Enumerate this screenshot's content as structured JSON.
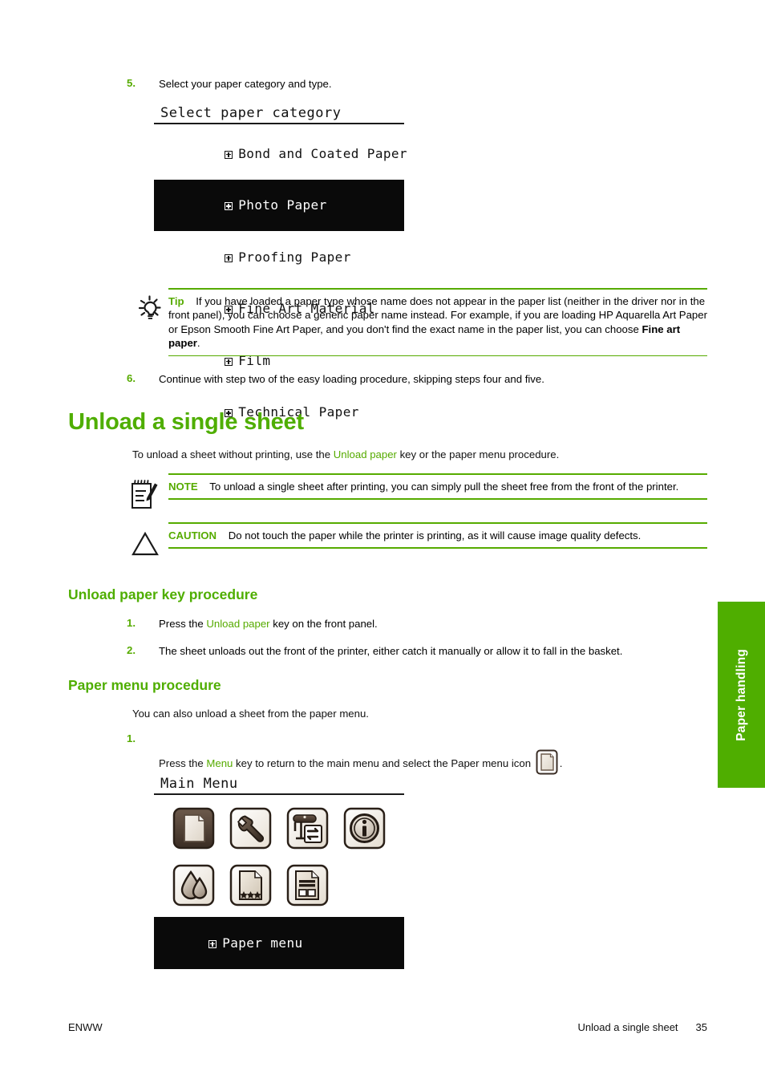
{
  "document": {
    "footer_left": "ENWW",
    "footer_section": "Unload a single sheet",
    "footer_page": "35",
    "side_tab": "Paper handling"
  },
  "steps_top": [
    {
      "num": "5.",
      "text": "Select your paper category and type."
    },
    {
      "num": "6.",
      "text": "Continue with step two of the easy loading procedure, skipping steps four and five."
    }
  ],
  "lcd_paper_category": {
    "title": "Select paper category",
    "rows": [
      {
        "label": "Bond and Coated Paper",
        "selected": false
      },
      {
        "label": "Photo Paper",
        "selected": true
      },
      {
        "label": "Proofing Paper",
        "selected": false
      },
      {
        "label": "Fine Art Material",
        "selected": false
      },
      {
        "label": "Film",
        "selected": false
      },
      {
        "label": "Technical Paper",
        "selected": false
      }
    ]
  },
  "tip": {
    "icon": "lightbulb-icon",
    "label": "Tip",
    "text_1": "If you have loaded a paper type whose name does not appear in the paper list (neither in the driver nor in the front panel), you can choose a generic paper name instead. For example, if you are loading HP Aquarella Art Paper or Epson Smooth Fine Art Paper, and you don't find the exact name in the paper list, you can choose ",
    "emphasis": "Fine art paper",
    "text_2": "."
  },
  "section": {
    "title": "Unload a single sheet",
    "intro_1": "To unload a sheet without printing, use the ",
    "intro_key": "Unload paper",
    "intro_2": " key or the paper menu procedure."
  },
  "note": {
    "icon": "note-pencil-icon",
    "label": "NOTE",
    "text": "To unload a single sheet after printing, you can simply pull the sheet free from the front of the printer."
  },
  "caution": {
    "icon": "warning-triangle-icon",
    "label": "CAUTION",
    "text": "Do not touch the paper while the printer is printing, as it will cause image quality defects."
  },
  "unload_key_procedure": {
    "title": "Unload paper key procedure",
    "steps": [
      {
        "num": "1.",
        "text_1": "Press the ",
        "key": "Unload paper",
        "text_2": " key on the front panel."
      },
      {
        "num": "2.",
        "text_1": "The sheet unloads out the front of the printer, either catch it manually or allow it to fall in the basket.",
        "key": "",
        "text_2": ""
      }
    ]
  },
  "paper_menu_procedure": {
    "title": "Paper menu procedure",
    "intro": "You can also unload a sheet from the paper menu.",
    "step_num": "1.",
    "step_text_1": "Press the ",
    "step_key": "Menu",
    "step_text_2": " key to return to the main menu and select the Paper menu icon ",
    "step_text_3": "."
  },
  "lcd_main_menu": {
    "title": "Main Menu",
    "icons": [
      "paper-menu-icon",
      "setup-wrench-icon",
      "job-management-icon",
      "information-icon",
      "ink-supplies-icon",
      "image-quality-icon",
      "internal-prints-icon"
    ],
    "selected_row": "Paper menu"
  },
  "colors": {
    "accent_green": "#4fae00",
    "link_green": "#56ab00",
    "lcd_selected_bg": "#0a0a0a",
    "lcd_selected_fg": "#ffffff"
  }
}
